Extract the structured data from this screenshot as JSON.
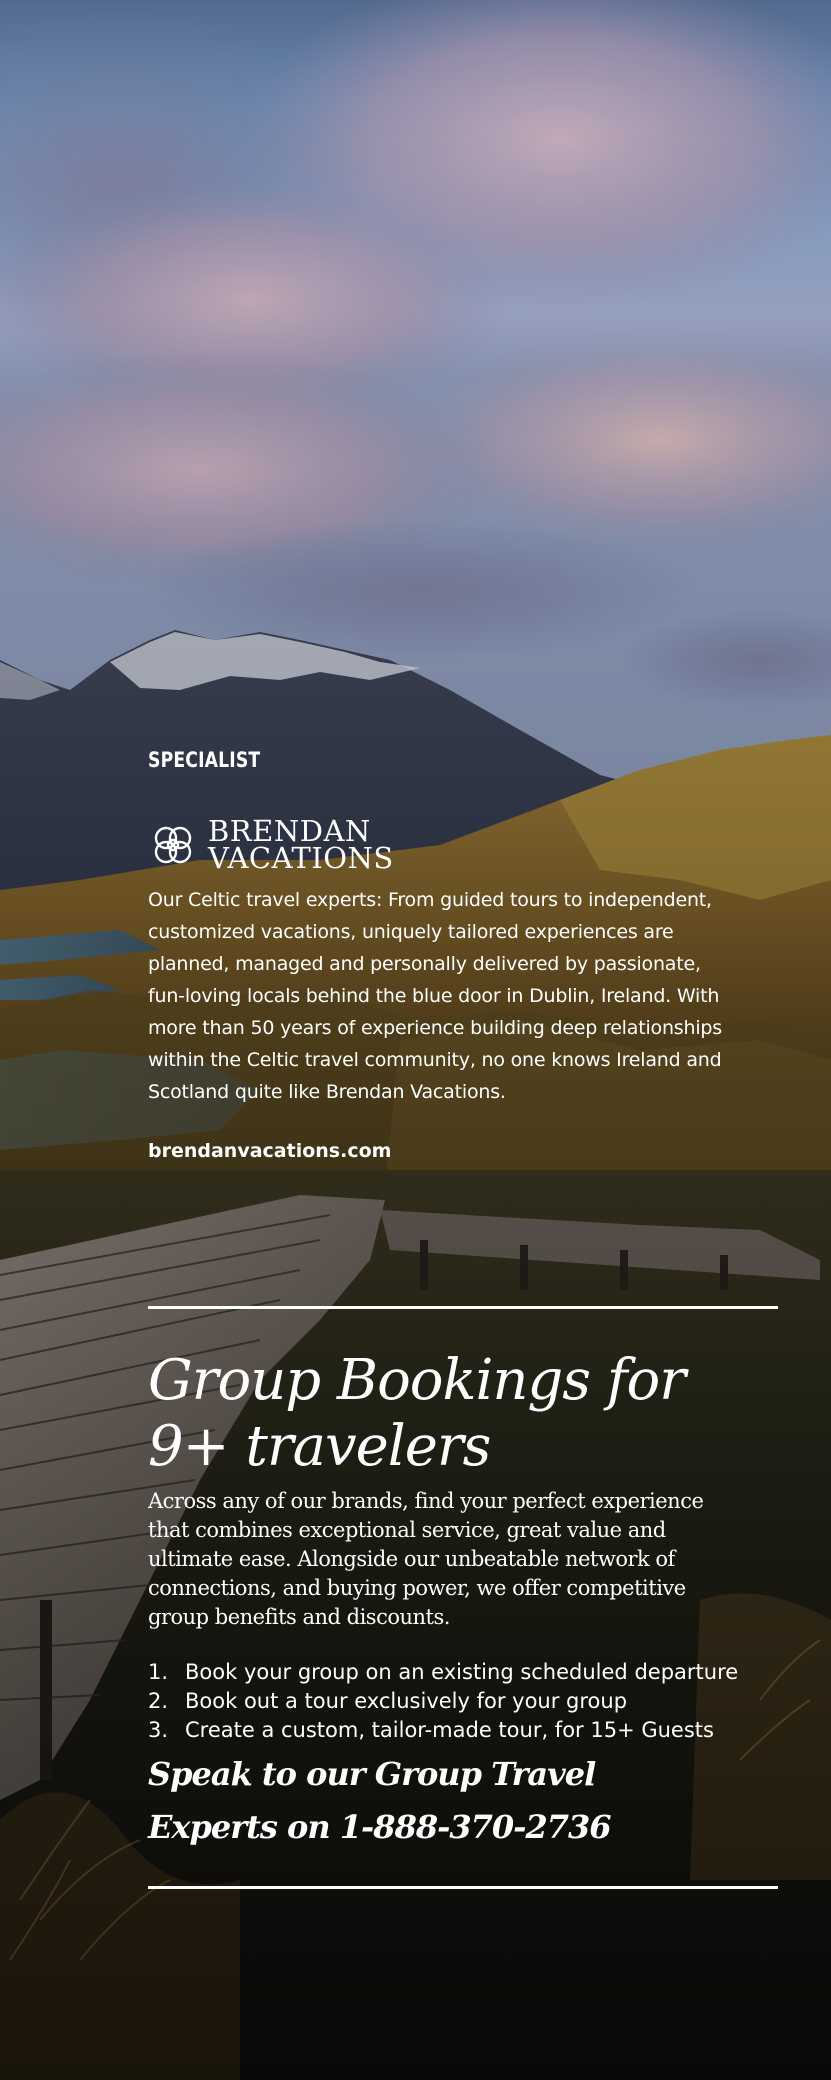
{
  "specialist": {
    "label": "SPECIALIST",
    "logo_icon": "celtic-knot-icon",
    "logo_line1": "BRENDAN",
    "logo_line2": "VACATIONS",
    "description": "Our Celtic travel experts: From guided tours to independent, customized vacations, uniquely tailored experiences are planned, managed and personally delivered by passionate, fun-loving locals behind the blue door in Dublin, Ireland. With more than 50 years of experience building deep relationships within the Celtic travel community, no one knows Ireland and Scotland quite like Brendan Vacations.",
    "website": "brendanvacations.com"
  },
  "group": {
    "heading_line1": "Group Bookings for",
    "heading_line2": "9+ travelers",
    "intro": "Across any of our brands, find your perfect experience that combines exceptional service, great value and ultimate ease. Alongside our unbeatable network of connections, and buying power, we offer competitive group benefits and discounts.",
    "options": [
      {
        "num": "1.",
        "text": "Book your group on an existing scheduled departure"
      },
      {
        "num": "2.",
        "text": "Book out a tour exclusively for your group"
      },
      {
        "num": "3.",
        "text": "Create a custom, tailor-made tour, for 15+ Guests"
      }
    ],
    "cta_line1": "Speak to our Group Travel",
    "cta_line2": "Experts on 1-888-370-2736"
  },
  "colors": {
    "text": "#ffffff",
    "sky": "#6f8fb8",
    "cloud": "#b6a0b6",
    "hills": "#8a6a2a"
  }
}
